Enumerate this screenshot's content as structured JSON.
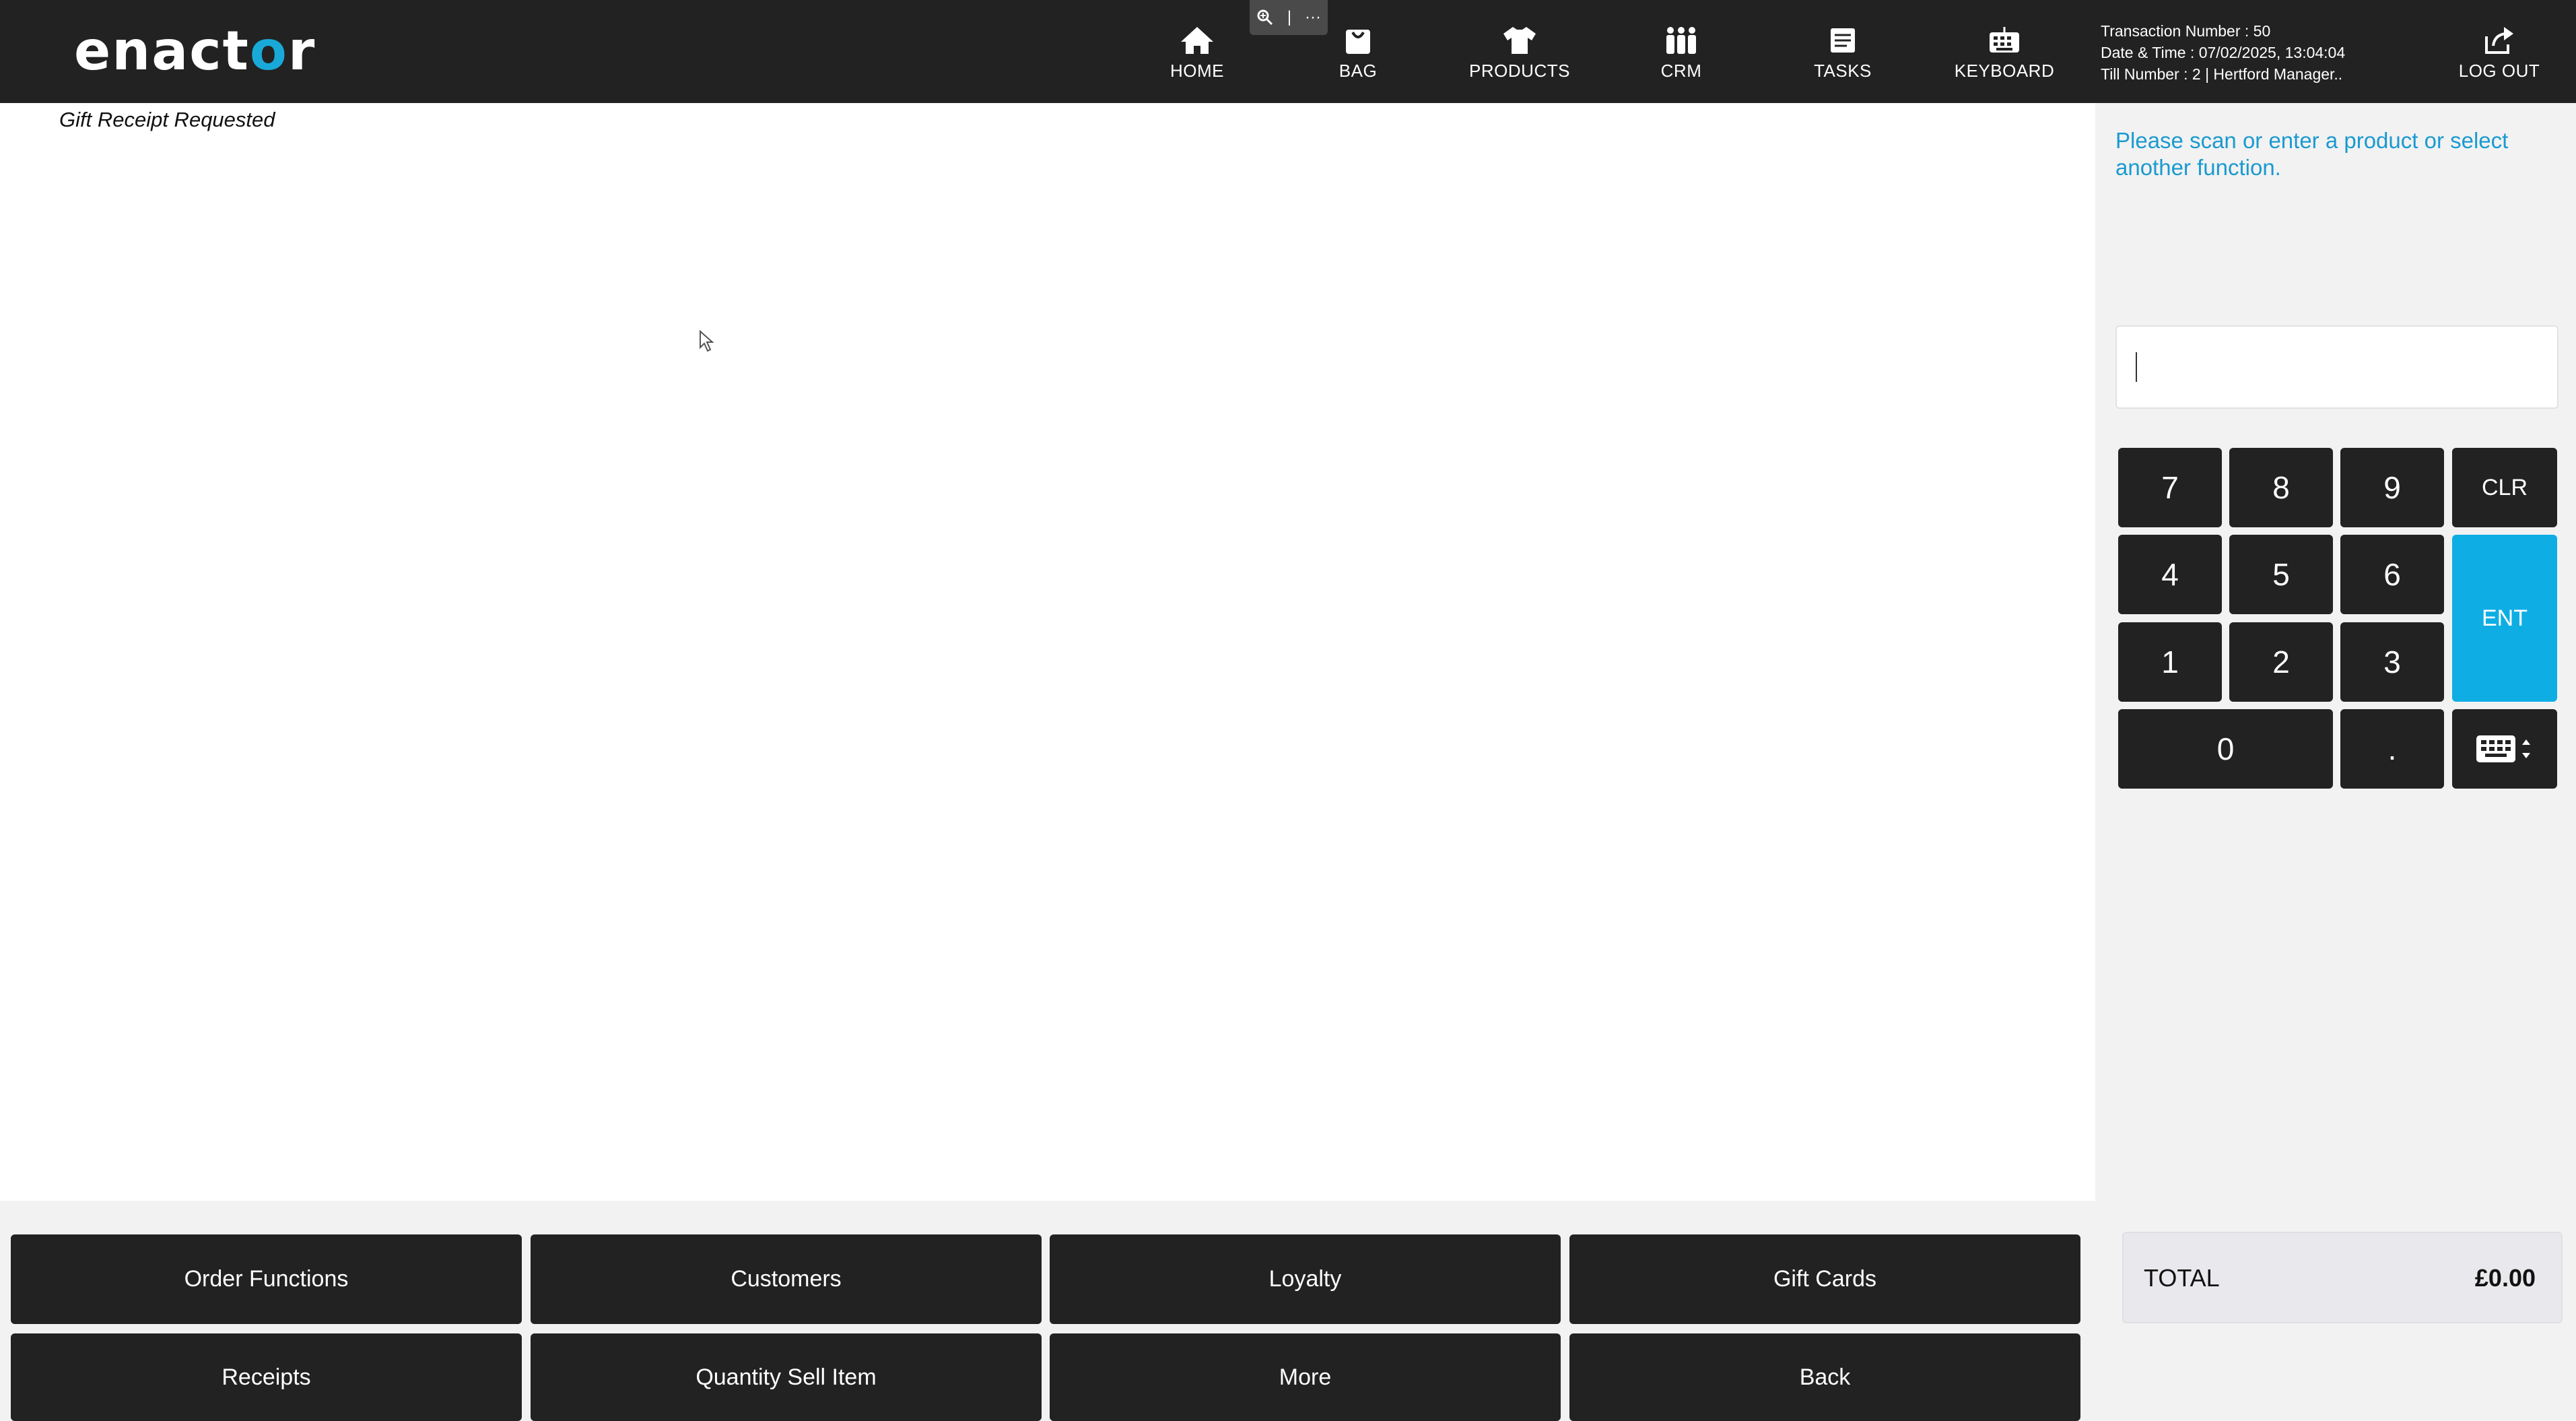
{
  "header": {
    "logo_text_pre": "enact",
    "logo_text_o": "o",
    "logo_text_post": "r",
    "zoom_toolbar": {
      "sep": "|",
      "more": "···"
    },
    "nav": [
      {
        "label": "HOME",
        "icon": "home-icon"
      },
      {
        "label": "BAG",
        "icon": "bag-icon"
      },
      {
        "label": "PRODUCTS",
        "icon": "tshirt-icon"
      },
      {
        "label": "CRM",
        "icon": "people-icon"
      },
      {
        "label": "TASKS",
        "icon": "tasks-icon"
      },
      {
        "label": "KEYBOARD",
        "icon": "keyboard-icon"
      },
      {
        "label": "LOG OUT",
        "icon": "logout-icon"
      }
    ],
    "transaction_number": "Transaction Number : 50",
    "date_time": "Date & Time : 07/02/2025, 13:04:04",
    "till_number": "Till Number : 2 | Hertford Manager.."
  },
  "main": {
    "notice": "Gift Receipt Requested"
  },
  "right_panel": {
    "prompt": "Please scan or enter a product or select another function.",
    "input_value": "",
    "keypad": {
      "k7": "7",
      "k8": "8",
      "k9": "9",
      "clr": "CLR",
      "k4": "4",
      "k5": "5",
      "k6": "6",
      "ent": "ENT",
      "k1": "1",
      "k2": "2",
      "k3": "3",
      "k0": "0",
      "dot": "."
    },
    "total_label": "TOTAL",
    "total_value": "£0.00"
  },
  "functions": [
    "Order Functions",
    "Customers",
    "Loyalty",
    "Gift Cards",
    "Receipts",
    "Quantity Sell Item",
    "More",
    "Back"
  ],
  "colors": {
    "header_bg": "#222222",
    "accent": "#0eaee4",
    "prompt_text": "#1a9ad0",
    "button_bg": "#222222",
    "panel_bg": "#f2f2f2"
  }
}
